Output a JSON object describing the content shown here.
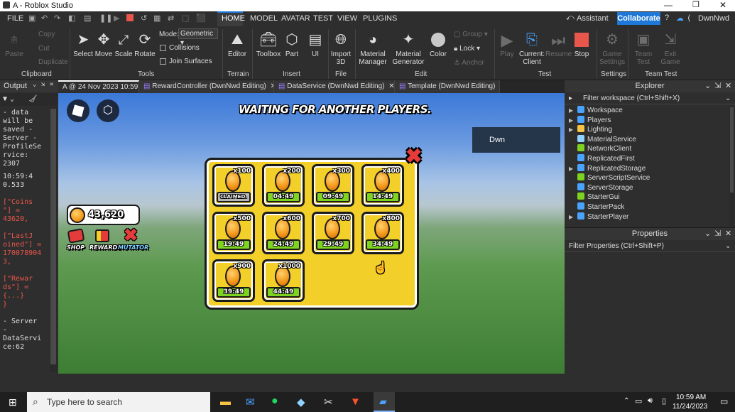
{
  "window": {
    "title": "A - Roblox Studio"
  },
  "menubar": {
    "file": "FILE",
    "tabs": [
      "HOME",
      "MODEL",
      "AVATAR",
      "TEST",
      "VIEW",
      "PLUGINS"
    ],
    "assistant": "Assistant",
    "collaborate": "Collaborate",
    "user": "DwnNwd"
  },
  "ribbon": {
    "clipboard": {
      "paste": "Paste",
      "copy": "Copy",
      "cut": "Cut",
      "duplicate": "Duplicate",
      "label": "Clipboard"
    },
    "tools": {
      "select": "Select",
      "move": "Move",
      "scale": "Scale",
      "rotate": "Rotate",
      "mode_label": "Mode:",
      "mode_value": "Geometric",
      "collisions": "Collisions",
      "join_surfaces": "Join Surfaces",
      "label": "Tools"
    },
    "terrain": {
      "editor": "Editor",
      "label": "Terrain"
    },
    "insert": {
      "toolbox": "Toolbox",
      "part": "Part",
      "ui": "UI",
      "label": "Insert"
    },
    "file": {
      "import3d": "Import 3D",
      "label": "File"
    },
    "edit": {
      "material_manager": "Material Manager",
      "material_generator": "Material Generator",
      "color": "Color",
      "group": "Group",
      "lock": "Lock",
      "anchor": "Anchor",
      "label": "Edit"
    },
    "test": {
      "play": "Play",
      "current_client": "Current: Client",
      "resume": "Resume",
      "stop": "Stop",
      "label": "Test"
    },
    "settings": {
      "game_settings": "Game Settings",
      "label": "Settings"
    },
    "team_test": {
      "team_test": "Team Test",
      "exit_game": "Exit Game",
      "label": "Team Test"
    }
  },
  "doc_tabs": [
    "A @ 24 Nov 2023 10:59",
    "RewardController (DwnNwd Editing)",
    "DataService (DwnNwd Editing)",
    "Template (DwnNwd Editing)"
  ],
  "output": {
    "title": "Output",
    "lines": [
      "- data",
      "will be",
      "saved  -",
      "Server -",
      "ProfileSe",
      "rvice:",
      "2307",
      "10:59:4",
      "0.533",
      "[\"Coins",
      "\"] =",
      "43620,",
      "[\"LastJ",
      "oined\"] =",
      "170078904",
      "3,",
      "[\"Rewar",
      "ds\"] =",
      "{...}",
      "}",
      "- Server",
      "-",
      "DataServi",
      "ce:62"
    ]
  },
  "game": {
    "heading": "WAITING FOR ANOTHER PLAYERS.",
    "player_name": "Dwn",
    "coins": "43,620",
    "buttons": {
      "shop": "SHOP",
      "rewards": "REWARDS",
      "mutator": "MUTATOR"
    },
    "rewards": [
      {
        "mult": "x100",
        "timer": "CLAIMED."
      },
      {
        "mult": "x200",
        "timer": "04:49"
      },
      {
        "mult": "x300",
        "timer": "09:49"
      },
      {
        "mult": "x400",
        "timer": "14:49"
      },
      {
        "mult": "x500",
        "timer": "19:49"
      },
      {
        "mult": "x600",
        "timer": "24:49"
      },
      {
        "mult": "x700",
        "timer": "29:49"
      },
      {
        "mult": "x800",
        "timer": "34:49"
      },
      {
        "mult": "x900",
        "timer": "39:49"
      },
      {
        "mult": "x1000",
        "timer": "44:49"
      }
    ]
  },
  "explorer": {
    "title": "Explorer",
    "filter": "Filter workspace (Ctrl+Shift+X)",
    "items": [
      "Workspace",
      "Players",
      "Lighting",
      "MaterialService",
      "NetworkClient",
      "ReplicatedFirst",
      "ReplicatedStorage",
      "ServerScriptService",
      "ServerStorage",
      "StarterGui",
      "StarterPack",
      "StarterPlayer"
    ]
  },
  "properties": {
    "title": "Properties",
    "filter": "Filter Properties (Ctrl+Shift+P)"
  },
  "taskbar": {
    "search_placeholder": "Type here to search",
    "time": "10:59 AM",
    "date": "11/24/2023"
  },
  "colors": {
    "accent": "#1e78d8",
    "stop": "#e9564b",
    "board": "#f3cf2a",
    "timer": "#7ed321"
  }
}
